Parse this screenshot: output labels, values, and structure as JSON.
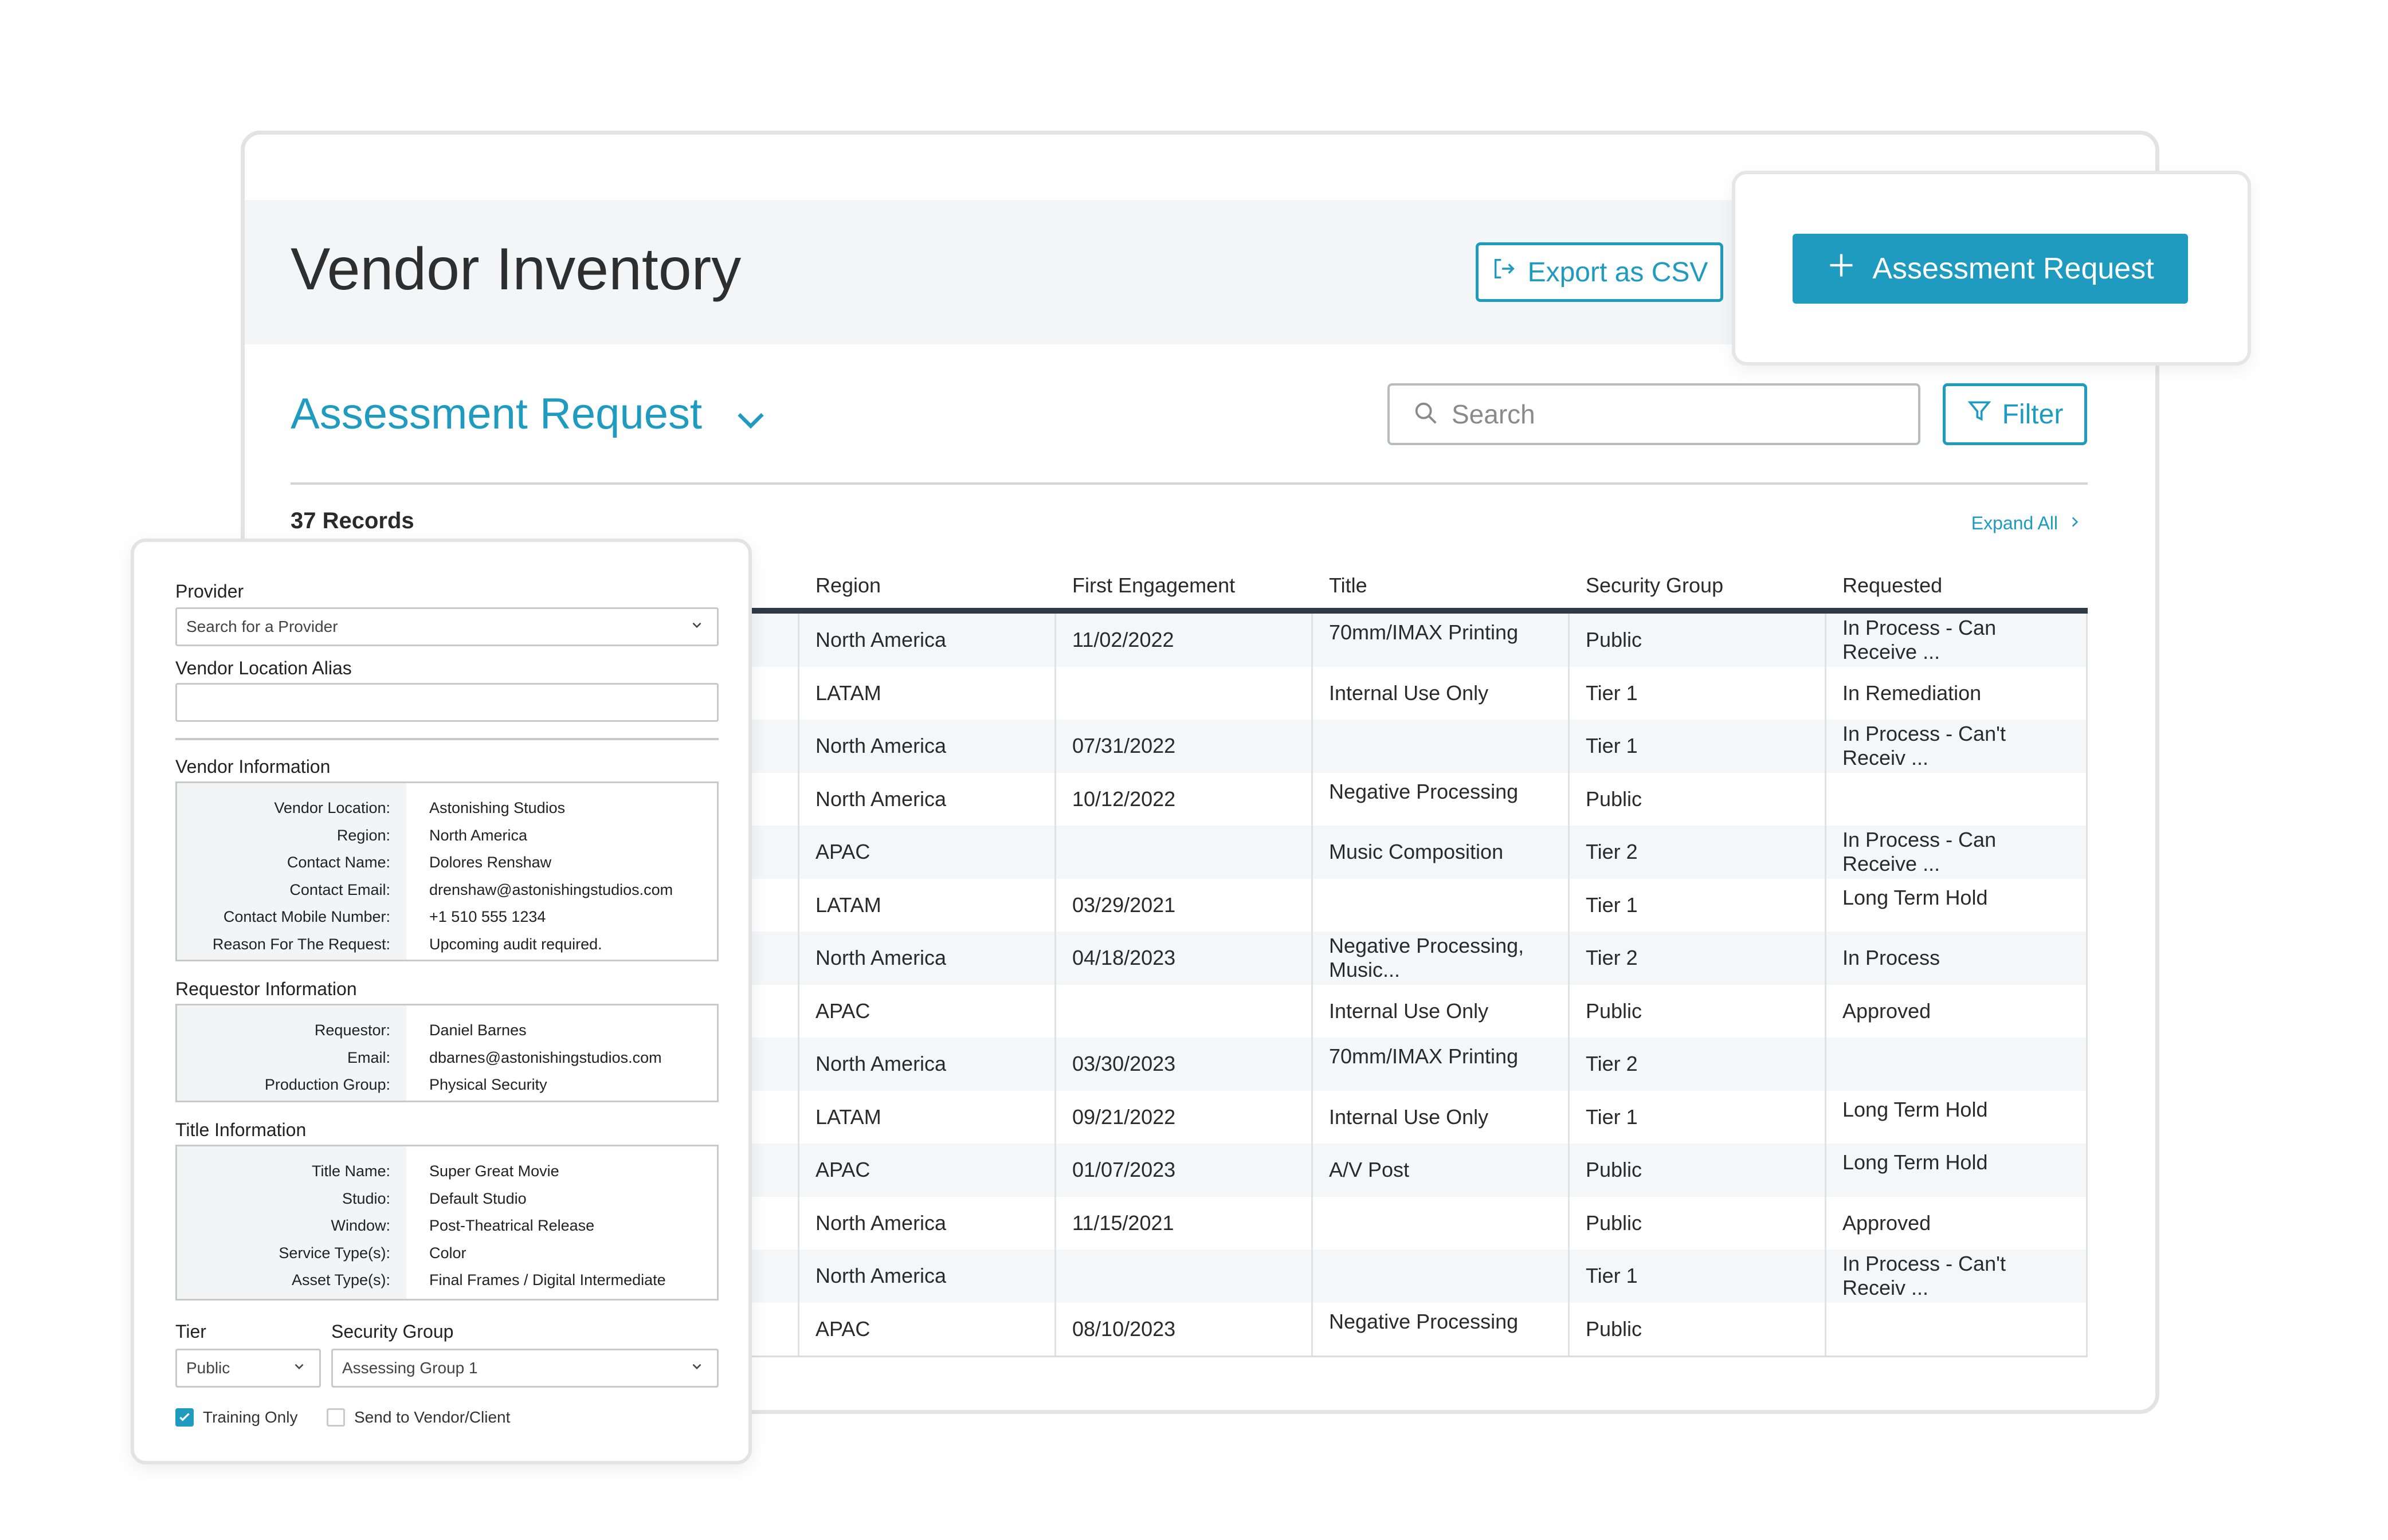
{
  "header": {
    "title": "Vendor Inventory",
    "export_label": "Export as CSV",
    "assessment_label": "Assessment Request"
  },
  "section": {
    "title": "Assessment Request",
    "search_placeholder": "Search",
    "filter_label": "Filter",
    "records": "37 Records",
    "expand_all": "Expand All"
  },
  "table": {
    "columns": [
      "",
      "Region",
      "First Engagement",
      "Title",
      "Security Group",
      "Requested"
    ],
    "rows": [
      [
        "",
        "North America",
        "11/02/2022",
        "70mm/IMAX Printing",
        "Public",
        "In Process - Can Receive ..."
      ],
      [
        "",
        "LATAM",
        "",
        "Internal Use Only",
        "Tier 1",
        "In Remediation"
      ],
      [
        "",
        "North America",
        "07/31/2022",
        "",
        "Tier 1",
        "In Process - Can't Receiv ..."
      ],
      [
        "",
        "North America",
        "10/12/2022",
        "Negative Processing",
        "Public",
        ""
      ],
      [
        "",
        "APAC",
        "",
        "Music Composition",
        "Tier 2",
        "In Process - Can Receive ..."
      ],
      [
        "",
        "LATAM",
        "03/29/2021",
        "",
        "Tier 1",
        "Long Term Hold"
      ],
      [
        "",
        "North America",
        "04/18/2023",
        "Negative Processing, Music...",
        "Tier 2",
        "In Process"
      ],
      [
        "",
        "APAC",
        "",
        "Internal Use Only",
        "Public",
        "Approved"
      ],
      [
        "",
        "North America",
        "03/30/2023",
        "70mm/IMAX Printing",
        "Tier 2",
        ""
      ],
      [
        "",
        "LATAM",
        "09/21/2022",
        "Internal Use Only",
        "Tier 1",
        "Long Term Hold"
      ],
      [
        "",
        "APAC",
        "01/07/2023",
        "A/V Post",
        "Public",
        "Long Term Hold"
      ],
      [
        "",
        "North America",
        "11/15/2021",
        "",
        "Public",
        "Approved"
      ],
      [
        "",
        "North America",
        "",
        "",
        "Tier 1",
        "In Process - Can't Receiv ..."
      ],
      [
        "",
        "APAC",
        "08/10/2023",
        "Negative Processing",
        "Public",
        ""
      ]
    ],
    "top_aligned": [
      [
        false,
        false,
        false,
        true,
        false,
        false
      ],
      [
        false,
        false,
        false,
        false,
        false,
        false
      ],
      [
        false,
        false,
        false,
        false,
        false,
        false
      ],
      [
        false,
        false,
        false,
        true,
        false,
        false
      ],
      [
        false,
        false,
        false,
        false,
        false,
        false
      ],
      [
        false,
        false,
        false,
        false,
        false,
        true
      ],
      [
        false,
        false,
        false,
        false,
        false,
        false
      ],
      [
        false,
        false,
        false,
        false,
        false,
        false
      ],
      [
        false,
        false,
        false,
        true,
        false,
        false
      ],
      [
        false,
        false,
        false,
        false,
        false,
        true
      ],
      [
        false,
        false,
        false,
        false,
        false,
        true
      ],
      [
        false,
        false,
        false,
        false,
        false,
        false
      ],
      [
        false,
        false,
        false,
        false,
        false,
        false
      ],
      [
        false,
        false,
        false,
        true,
        false,
        false
      ]
    ]
  },
  "form": {
    "provider_label": "Provider",
    "provider_placeholder": "Search for a Provider",
    "alias_label": "Vendor Location Alias",
    "alias_value": "",
    "vendor_info": {
      "heading": "Vendor Information",
      "keys": [
        "Vendor Location:",
        "Region:",
        "Contact Name:",
        "Contact Email:",
        "Contact Mobile Number:",
        "Reason For The Request:"
      ],
      "values": [
        "Astonishing Studios",
        "North America",
        "Dolores Renshaw",
        "drenshaw@astonishingstudios.com",
        "+1 510 555 1234",
        "Upcoming audit required."
      ]
    },
    "requestor_info": {
      "heading": "Requestor Information",
      "keys": [
        "Requestor:",
        "Email:",
        "Production Group:"
      ],
      "values": [
        "Daniel Barnes",
        "dbarnes@astonishingstudios.com",
        "Physical Security"
      ]
    },
    "title_info": {
      "heading": "Title Information",
      "keys": [
        "Title Name:",
        "Studio:",
        "Window:",
        "Service Type(s):",
        "Asset Type(s):"
      ],
      "values": [
        "Super Great Movie",
        "Default Studio",
        "Post-Theatrical Release",
        "Color",
        "Final Frames / Digital Intermediate"
      ]
    },
    "tier_label": "Tier",
    "tier_value": "Public",
    "security_label": "Security Group",
    "security_value": "Assessing Group 1",
    "training_label": "Training Only",
    "training_checked": true,
    "send_label": "Send to Vendor/Client",
    "send_checked": false
  },
  "colors": {
    "accent": "#1e9bbf",
    "header_bg": "#f4f5f6",
    "table_header_rule": "#2e3a44"
  },
  "icons": [
    "export-icon",
    "plus-icon",
    "chevron-down-icon",
    "search-icon",
    "filter-icon",
    "chevron-right-icon",
    "check-icon"
  ]
}
